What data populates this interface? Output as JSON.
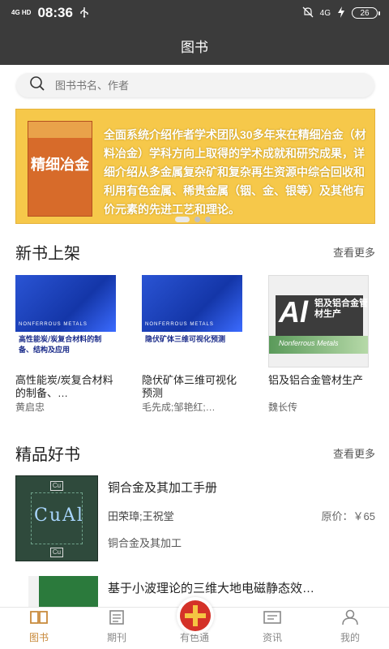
{
  "status": {
    "network": "4G HD",
    "time": "08:36",
    "usb_icon": "usb-icon",
    "right_network": "4G",
    "battery": "26"
  },
  "header": {
    "title": "图书"
  },
  "search": {
    "placeholder": "图书书名、作者"
  },
  "banner": {
    "book_title": "精细冶金",
    "text": "全面系统介绍作者学术团队30多年来在精细冶金（材料冶金）学科方向上取得的学术成就和研究成果，详细介绍从多金属复杂矿和复杂再生资源中综合回收和利用有色金属、稀贵金属（铟、金、银等）及其他有价元素的先进工艺和理论。",
    "dots": 3,
    "active_dot": 0
  },
  "new_books": {
    "title": "新书上架",
    "more": "查看更多",
    "items": [
      {
        "name": "高性能炭/炭复合材料的制备、…",
        "author": "黄启忠",
        "cover_title": "高性能炭/炭复合材料的制备、结构及应用",
        "cover_sub": "NONFERROUS METALS"
      },
      {
        "name": "隐伏矿体三维可视化预测",
        "author": "毛先成;邹艳红;…",
        "cover_title": "隐伏矿体三维可视化预测",
        "cover_sub": "NONFERROUS METALS"
      },
      {
        "name": "铝及铝合金管材生产",
        "author": "魏长传",
        "cover_title": "铝及铝合金管材生产",
        "cover_sub": "Nonferrous Metals"
      }
    ]
  },
  "featured": {
    "title": "精品好书",
    "more": "查看更多",
    "items": [
      {
        "title": "铜合金及其加工手册",
        "author": "田荣璋;王祝堂",
        "price": "原价：￥65",
        "tag": "铜合金及其加工"
      },
      {
        "title": "基于小波理论的三维大地电磁静态效…",
        "author": "",
        "price": "",
        "tag": ""
      }
    ]
  },
  "tabs": [
    {
      "label": "图书",
      "icon": "book-icon",
      "active": true
    },
    {
      "label": "期刊",
      "icon": "journal-icon",
      "active": false
    },
    {
      "label": "有色通",
      "icon": "youse-logo-icon",
      "active": false
    },
    {
      "label": "资讯",
      "icon": "news-icon",
      "active": false
    },
    {
      "label": "我的",
      "icon": "user-icon",
      "active": false
    }
  ],
  "colors": {
    "header_bg": "#3b3b3b",
    "accent": "#c8893a",
    "banner_bg": "#f6c84a"
  }
}
